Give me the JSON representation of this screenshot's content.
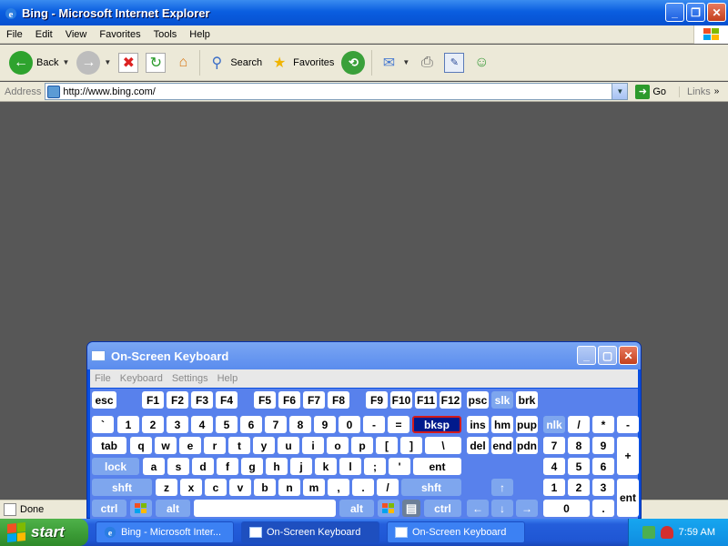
{
  "window": {
    "title": "Bing - Microsoft Internet Explorer"
  },
  "menu": [
    "File",
    "Edit",
    "View",
    "Favorites",
    "Tools",
    "Help"
  ],
  "toolbar": {
    "back_label": "Back",
    "search_label": "Search",
    "favorites_label": "Favorites"
  },
  "address": {
    "label": "Address",
    "url": "http://www.bing.com/",
    "go_label": "Go",
    "links_label": "Links"
  },
  "status": {
    "text": "Done"
  },
  "osk": {
    "title": "On-Screen Keyboard",
    "menu": [
      "File",
      "Keyboard",
      "Settings",
      "Help"
    ],
    "keys": {
      "esc": "esc",
      "f1": "F1",
      "f2": "F2",
      "f3": "F3",
      "f4": "F4",
      "f5": "F5",
      "f6": "F6",
      "f7": "F7",
      "f8": "F8",
      "f9": "F9",
      "f10": "F10",
      "f11": "F11",
      "f12": "F12",
      "psc": "psc",
      "slk": "slk",
      "brk": "brk",
      "grave": "`",
      "d1": "1",
      "d2": "2",
      "d3": "3",
      "d4": "4",
      "d5": "5",
      "d6": "6",
      "d7": "7",
      "d8": "8",
      "d9": "9",
      "d0": "0",
      "minus": "-",
      "equals": "=",
      "bksp": "bksp",
      "ins": "ins",
      "hm": "hm",
      "pup": "pup",
      "nlk": "nlk",
      "kpdiv": "/",
      "kpmul": "*",
      "kpsub": "-",
      "tab": "tab",
      "q": "q",
      "w": "w",
      "e": "e",
      "r": "r",
      "t": "t",
      "y": "y",
      "u": "u",
      "i": "i",
      "o": "o",
      "p": "p",
      "lbr": "[",
      "rbr": "]",
      "bslash": "\\",
      "del": "del",
      "end": "end",
      "pdn": "pdn",
      "kp7": "7",
      "kp8": "8",
      "kp9": "9",
      "kpadd": "+",
      "lock": "lock",
      "a": "a",
      "s": "s",
      "d": "d",
      "f": "f",
      "g": "g",
      "h": "h",
      "j": "j",
      "k": "k",
      "l": "l",
      "semi": ";",
      "quote": "'",
      "ent": "ent",
      "kp4": "4",
      "kp5": "5",
      "kp6": "6",
      "lshft": "shft",
      "z": "z",
      "x": "x",
      "c": "c",
      "v": "v",
      "b": "b",
      "n": "n",
      "m": "m",
      "comma": ",",
      "period": ".",
      "slash": "/",
      "rshft": "shft",
      "up": "↑",
      "kp1": "1",
      "kp2": "2",
      "kp3": "3",
      "kpent": "ent",
      "lctrl": "ctrl",
      "lalt": "alt",
      "ralt": "alt",
      "rctrl": "ctrl",
      "left": "←",
      "down": "↓",
      "right": "→",
      "kp0": "0",
      "kpdot": "."
    }
  },
  "taskbar": {
    "start_label": "start",
    "tasks": [
      "Bing - Microsoft Inter...",
      "On-Screen Keyboard",
      "On-Screen Keyboard"
    ],
    "clock": "7:59 AM"
  },
  "colors": {
    "xp_blue": "#0a4fe0",
    "start_green": "#3a9a35",
    "osk_body": "#5881ec"
  }
}
